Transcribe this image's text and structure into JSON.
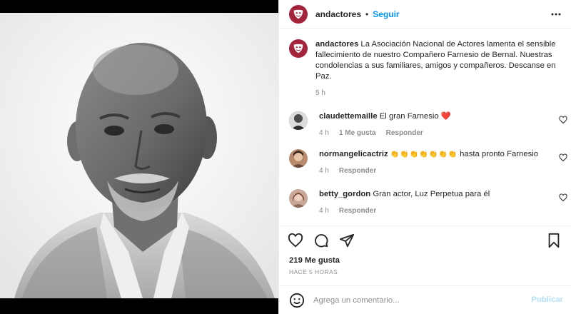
{
  "post": {
    "username": "andactores",
    "follow_label": "Seguir",
    "separator": "•",
    "photo_alt": "Fotografía en blanco y negro de Farnesio de Bernal"
  },
  "caption": {
    "username": "andactores",
    "text": "La Asociación Nacional de Actores lamenta el sensible fallecimiento de nuestro Compañero Farnesio de Bernal. Nuestras condolencias a sus familiares, amigos y compañeros. Descanse en Paz.",
    "time": "5 h"
  },
  "comments": [
    {
      "username": "claudettemaille",
      "text": "El gran Farnesio",
      "time": "4 h",
      "likes": "1 Me gusta",
      "reply": "Responder",
      "emoji": "❤️"
    },
    {
      "username": "normangelicactriz",
      "text": "hasta pronto Farnesio",
      "time": "4 h",
      "reply": "Responder",
      "emoji": "👏👏👏👏👏👏👏"
    },
    {
      "username": "betty_gordon",
      "text": "Gran actor, Luz Perpetua para él",
      "time": "4 h",
      "reply": "Responder"
    }
  ],
  "stats": {
    "likes": "219 Me gusta",
    "time_ago": "HACE 5 HORAS"
  },
  "composer": {
    "placeholder": "Agrega un comentario...",
    "publish_label": "Publicar"
  },
  "colors": {
    "brand": "#a3233a",
    "link": "#0095f6",
    "publish_disabled": "#b2dffc"
  }
}
